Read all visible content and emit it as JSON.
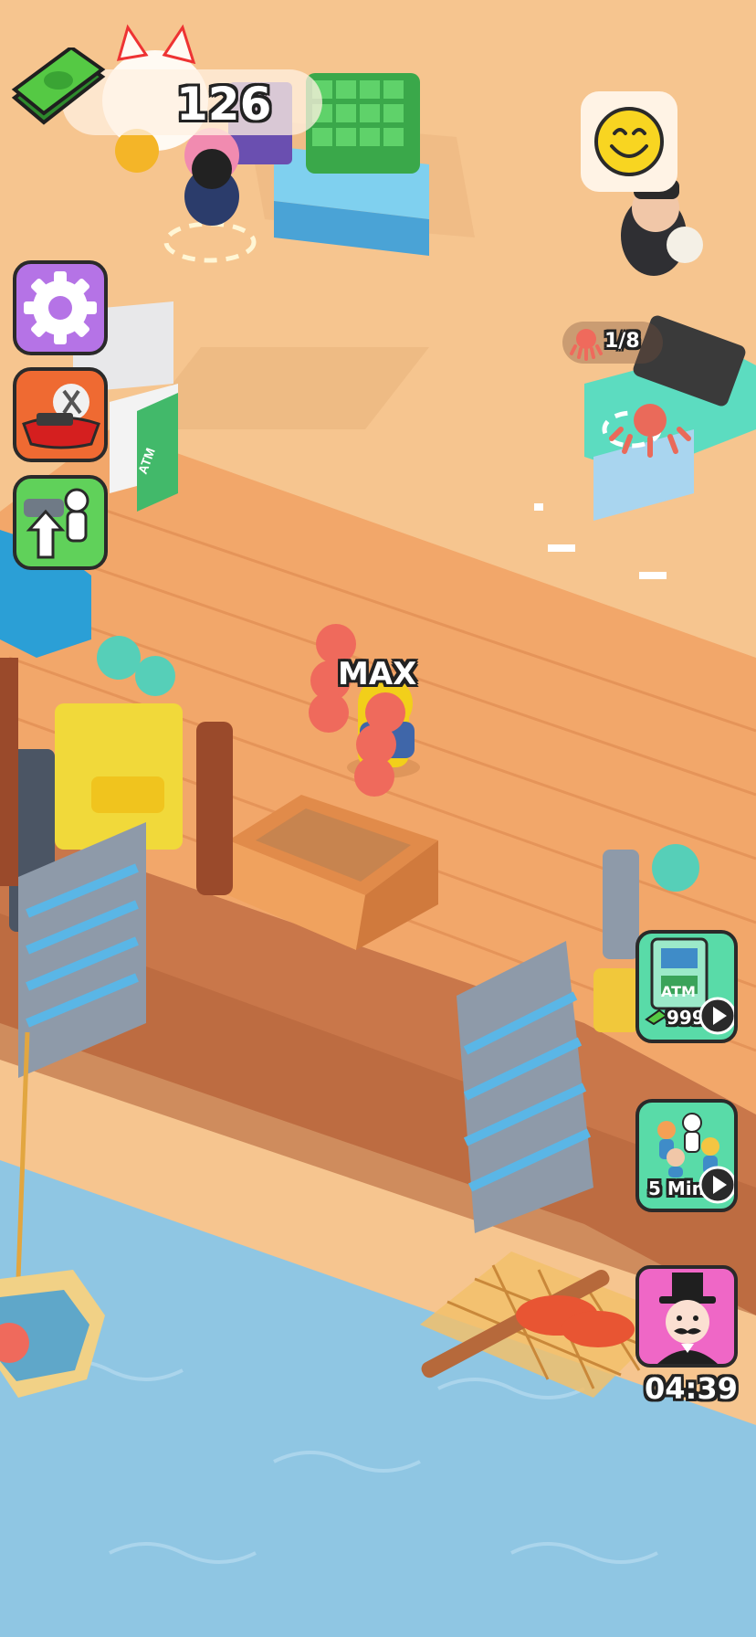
{
  "currency": {
    "amount": "126",
    "icon": "cash-stack-icon"
  },
  "side_buttons": [
    {
      "id": "settings",
      "icon": "gear-icon"
    },
    {
      "id": "restaurant",
      "icon": "boat-restaurant-icon"
    },
    {
      "id": "hire_upgrade",
      "icon": "hire-upgrade-icon"
    }
  ],
  "customer": {
    "mood_icon": "smiley-face-icon",
    "order_icon": "octopus-icon",
    "order_count": "1/8"
  },
  "player": {
    "stack_label": "MAX"
  },
  "offers": {
    "atm": {
      "label": "ATM",
      "price": "999",
      "icon": "atm-machine-icon",
      "action_icon": "play-video-icon"
    },
    "staff": {
      "duration": "5 Min",
      "icon": "staff-rush-icon",
      "action_icon": "play-video-icon"
    },
    "vip": {
      "timer": "04:39",
      "icon": "gentleman-avatar-icon"
    }
  },
  "signs": {
    "atm_wall": "ATM"
  },
  "colors": {
    "sand": "#f6c58f",
    "deck": "#f2a76a",
    "water": "#8fc6e3",
    "button_purple": "#b573e6",
    "button_green": "#60d15a",
    "button_orange": "#ef6a32",
    "vip_pink": "#ef67c6"
  }
}
